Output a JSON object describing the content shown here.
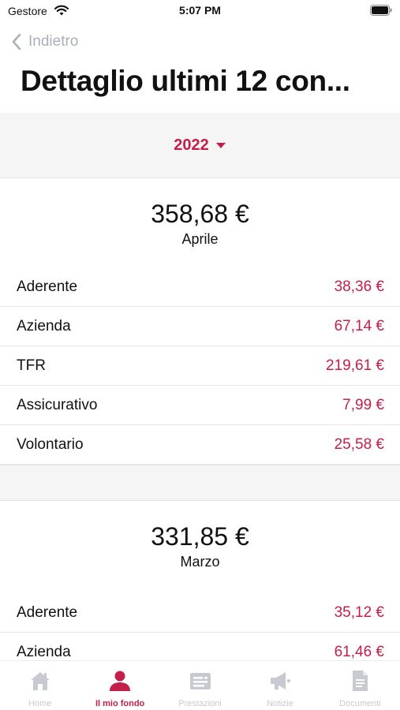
{
  "status": {
    "carrier": "Gestore",
    "time": "5:07 PM"
  },
  "nav": {
    "back_label": "Indietro",
    "title": "Dettaglio ultimi 12 con..."
  },
  "year_picker": {
    "selected": "2022"
  },
  "months": [
    {
      "total": "358,68 €",
      "name": "Aprile",
      "rows": [
        {
          "label": "Aderente",
          "value": "38,36 €"
        },
        {
          "label": "Azienda",
          "value": "67,14 €"
        },
        {
          "label": "TFR",
          "value": "219,61 €"
        },
        {
          "label": "Assicurativo",
          "value": "7,99 €"
        },
        {
          "label": "Volontario",
          "value": "25,58 €"
        }
      ]
    },
    {
      "total": "331,85 €",
      "name": "Marzo",
      "rows": [
        {
          "label": "Aderente",
          "value": "35,12 €"
        },
        {
          "label": "Azienda",
          "value": "61,46 €"
        }
      ]
    }
  ],
  "tabs": [
    {
      "label": "Home",
      "icon": "home-icon"
    },
    {
      "label": "Il mio fondo",
      "icon": "person-icon",
      "active": true
    },
    {
      "label": "Prestazioni",
      "icon": "list-card-icon"
    },
    {
      "label": "Notizie",
      "icon": "megaphone-icon"
    },
    {
      "label": "Documenti",
      "icon": "document-icon"
    }
  ],
  "colors": {
    "accent": "#c41e4a",
    "inactive": "#c7cbd1",
    "band": "#f5f5f5"
  }
}
